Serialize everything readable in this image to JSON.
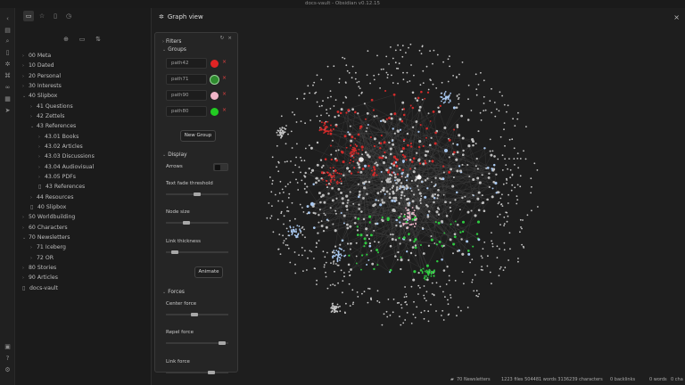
{
  "window": {
    "title": "docs-vault - Obsidian v0.12.15"
  },
  "ribbon": {
    "icons": [
      "collapse-icon",
      "files-icon",
      "search-icon",
      "graph-icon",
      "tag-icon",
      "link-icon",
      "calendar-icon",
      "send-icon",
      "help-icon",
      "settings-icon"
    ]
  },
  "sidebar": {
    "tabs": [
      "files-tab",
      "starred-tab",
      "outline-tab",
      "recent-tab"
    ],
    "actions": [
      "new-note",
      "new-folder",
      "sort"
    ],
    "tree": [
      {
        "label": "00 Meta",
        "depth": 0,
        "type": "folder",
        "open": false
      },
      {
        "label": "10 Dated",
        "depth": 0,
        "type": "folder",
        "open": false
      },
      {
        "label": "20 Personal",
        "depth": 0,
        "type": "folder",
        "open": false
      },
      {
        "label": "30 Interests",
        "depth": 0,
        "type": "folder",
        "open": false
      },
      {
        "label": "40 Slipbox",
        "depth": 0,
        "type": "folder",
        "open": true
      },
      {
        "label": "41 Questions",
        "depth": 1,
        "type": "folder",
        "open": false
      },
      {
        "label": "42 Zettels",
        "depth": 1,
        "type": "folder",
        "open": false
      },
      {
        "label": "43 References",
        "depth": 1,
        "type": "folder",
        "open": true
      },
      {
        "label": "43.01 Books",
        "depth": 2,
        "type": "folder",
        "open": false
      },
      {
        "label": "43.02 Articles",
        "depth": 2,
        "type": "folder",
        "open": false
      },
      {
        "label": "43.03 Discussions",
        "depth": 2,
        "type": "folder",
        "open": false
      },
      {
        "label": "43.04 Audiovisual",
        "depth": 2,
        "type": "folder",
        "open": false
      },
      {
        "label": "43.05 PDFs",
        "depth": 2,
        "type": "folder",
        "open": false
      },
      {
        "label": "43 References",
        "depth": 2,
        "type": "file"
      },
      {
        "label": "44 Resources",
        "depth": 1,
        "type": "folder",
        "open": false
      },
      {
        "label": "40 Slipbox",
        "depth": 1,
        "type": "file"
      },
      {
        "label": "50 Worldbuilding",
        "depth": 0,
        "type": "folder",
        "open": false
      },
      {
        "label": "60 Characters",
        "depth": 0,
        "type": "folder",
        "open": false
      },
      {
        "label": "70 Newsletters",
        "depth": 0,
        "type": "folder",
        "open": true
      },
      {
        "label": "71 Iceberg",
        "depth": 1,
        "type": "folder",
        "open": false
      },
      {
        "label": "72 OR",
        "depth": 1,
        "type": "folder",
        "open": false
      },
      {
        "label": "80 Stories",
        "depth": 0,
        "type": "folder",
        "open": false
      },
      {
        "label": "90 Articles",
        "depth": 0,
        "type": "folder",
        "open": false
      },
      {
        "label": "docs-vault",
        "depth": 0,
        "type": "file"
      }
    ]
  },
  "graph_view": {
    "title": "Graph view",
    "panel": {
      "filters_label": "Filters",
      "groups_label": "Groups",
      "groups": [
        {
          "query": "path42",
          "color": "#e02424"
        },
        {
          "query": "path71",
          "color": "#2e8b2e"
        },
        {
          "query": "path90",
          "color": "#f0b4c8"
        },
        {
          "query": "path80",
          "color": "#22cc22"
        }
      ],
      "new_group_label": "New Group",
      "display_label": "Display",
      "arrows_label": "Arrows",
      "text_fade_label": "Text fade threshold",
      "text_fade_value": 0.5,
      "node_size_label": "Node size",
      "node_size_value": 0.3,
      "link_thickness_label": "Link thickness",
      "link_thickness_value": 0.1,
      "animate_label": "Animate",
      "forces_label": "Forces",
      "center_force_label": "Center force",
      "center_force_value": 0.45,
      "repel_force_label": "Repel force",
      "repel_force_value": 0.95,
      "link_force_label": "Link force",
      "link_force_value": 0.75
    }
  },
  "statusbar": {
    "folder": "70 Newsletters",
    "stats": "1223 files 504481 words 3136239 characters",
    "backlinks": "0 backlinks",
    "words": "0 words",
    "chars": "0 cha"
  }
}
